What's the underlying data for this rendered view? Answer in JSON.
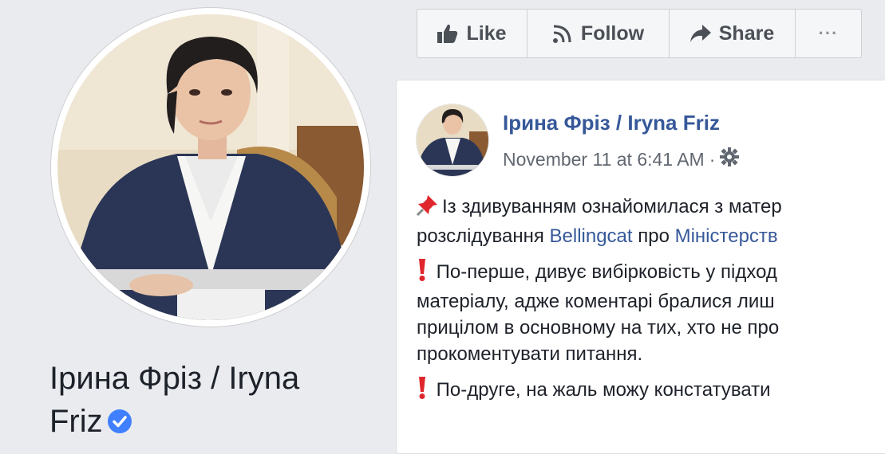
{
  "profile": {
    "name_line1": "Ірина Фріз / Iryna",
    "name_line2": "Friz",
    "verified": true
  },
  "action_bar": {
    "like_label": "Like",
    "follow_label": "Follow",
    "share_label": "Share",
    "more_label": "···"
  },
  "post": {
    "author": "Ірина Фріз / Iryna Friz",
    "timestamp": "November 11 at 6:41 AM",
    "separator": "·",
    "paragraph1": {
      "line1": "Із здивуванням ознайомилася з матер",
      "line2_prefix": "розслідування ",
      "link1": "Bellingcat",
      "line2_middle": " про ",
      "link2": "Міністерств"
    },
    "paragraph2": {
      "line1": " По-перше, дивує вибірковість у підход",
      "line2": "матеріалу, адже коментарі бралися лиш",
      "line3": "прицілом в основному на тих, хто не про",
      "line4": "прокоментувати питання."
    },
    "paragraph3": {
      "line1": " По-друге, на жаль можу констатувати"
    }
  },
  "icons": {
    "like": "thumbs-up-icon",
    "follow": "rss-icon",
    "share": "share-arrow-icon",
    "settings": "gear-icon",
    "pin": "pushpin-icon",
    "exclamation": "red-exclamation-icon",
    "verified": "verified-check-icon"
  },
  "colors": {
    "link": "#365899",
    "verified": "#4080ff",
    "background": "#e9ebee"
  }
}
